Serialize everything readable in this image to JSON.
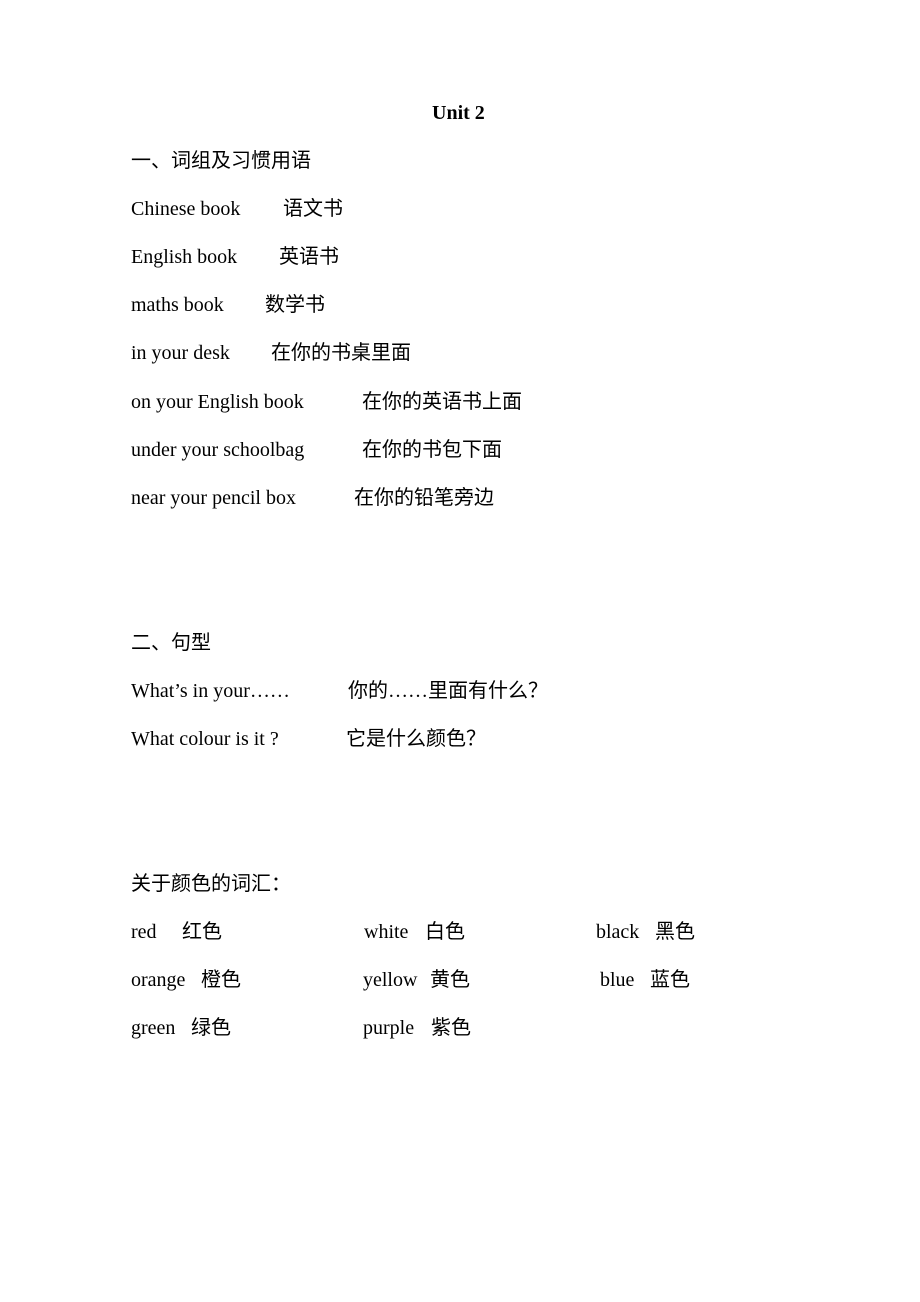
{
  "title": "Unit 2",
  "section1": {
    "heading": "一、词组及习惯用语",
    "phrases": [
      {
        "en": "Chinese book",
        "zh": "语文书"
      },
      {
        "en": "English book",
        "zh": "英语书"
      },
      {
        "en": "maths book",
        "zh": "数学书"
      },
      {
        "en": "in your desk",
        "zh": "在你的书桌里面"
      },
      {
        "en": "on your English book",
        "zh": "在你的英语书上面"
      },
      {
        "en": "under your schoolbag",
        "zh": "在你的书包下面"
      },
      {
        "en": "near your pencil box",
        "zh": "在你的铅笔旁边"
      }
    ]
  },
  "section2": {
    "heading": "二、句型",
    "sentences": [
      {
        "en": "What’s in your……",
        "zh": "你的……里面有什么？"
      },
      {
        "en": "What colour is it ?",
        "zh": "它是什么颜色？"
      }
    ]
  },
  "section3": {
    "heading": "关于颜色的词汇：",
    "colors": [
      {
        "en": "red",
        "zh": "红色"
      },
      {
        "en": "white",
        "zh": "白色"
      },
      {
        "en": "black",
        "zh": "黑色"
      },
      {
        "en": "orange",
        "zh": "橙色"
      },
      {
        "en": "yellow",
        "zh": "黄色"
      },
      {
        "en": "blue",
        "zh": "蓝色"
      },
      {
        "en": "green",
        "zh": "绿色"
      },
      {
        "en": "purple",
        "zh": "紫色"
      }
    ]
  }
}
